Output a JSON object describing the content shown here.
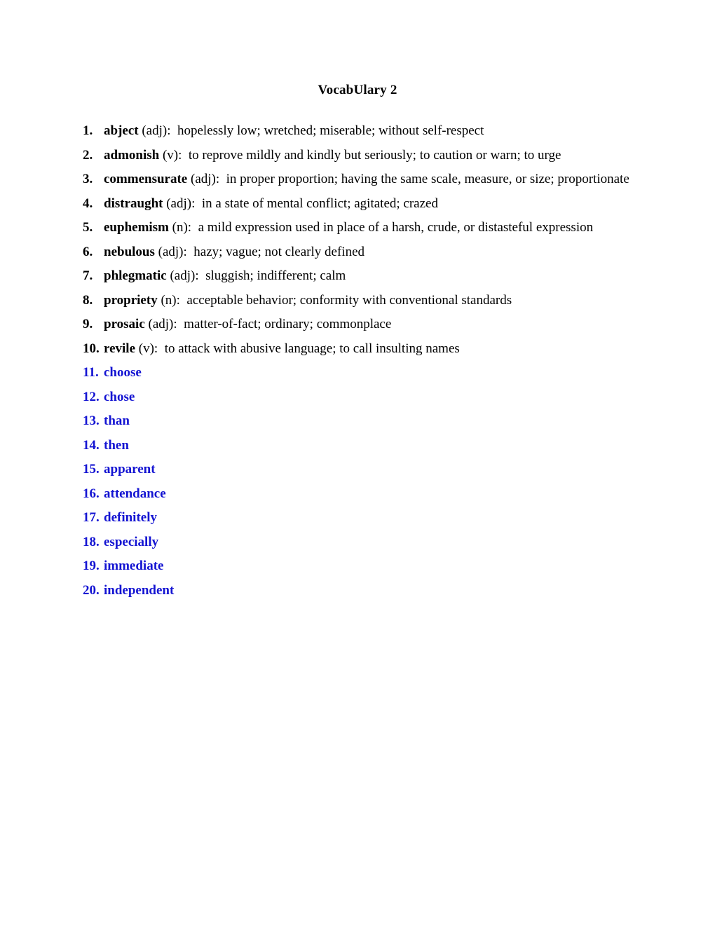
{
  "document": {
    "title": "VocabUlary 2",
    "accent_blue": "#1414d2",
    "text_color": "#000000",
    "background": "#ffffff"
  },
  "items": [
    {
      "number": "1.",
      "term": "abject",
      "pos": "(adj):",
      "definition": "hopelessly low; wretched; miserable; without self-respect",
      "style": "defined"
    },
    {
      "number": "2.",
      "term": "admonish",
      "pos": "(v):",
      "definition": "to reprove mildly and kindly but seriously; to caution or warn; to urge",
      "style": "defined"
    },
    {
      "number": "3.",
      "term": "commensurate",
      "pos": "(adj):",
      "definition": "in proper proportion; having the same scale, measure, or size; proportionate",
      "style": "defined"
    },
    {
      "number": "4.",
      "term": "distraught",
      "pos": "(adj):",
      "definition": "in a state of mental conflict; agitated; crazed",
      "style": "defined"
    },
    {
      "number": "5.",
      "term": "euphemism",
      "pos": "(n):",
      "definition": "a mild expression used in place of a harsh, crude, or distasteful expression",
      "style": "defined"
    },
    {
      "number": "6.",
      "term": "nebulous",
      "pos": "(adj):",
      "definition": "hazy; vague; not clearly defined",
      "style": "defined"
    },
    {
      "number": "7.",
      "term": "phlegmatic",
      "pos": "(adj):",
      "definition": "sluggish; indifferent; calm",
      "style": "defined"
    },
    {
      "number": "8.",
      "term": "propriety",
      "pos": "(n):",
      "definition": "acceptable behavior; conformity with conventional standards",
      "style": "defined"
    },
    {
      "number": "9.",
      "term": "prosaic",
      "pos": "(adj):",
      "definition": "matter-of-fact; ordinary; commonplace",
      "style": "defined"
    },
    {
      "number": "10.",
      "term": "revile",
      "pos": "(v):",
      "definition": "to attack with abusive language; to call insulting names",
      "style": "defined"
    },
    {
      "number": "11.",
      "term": "choose",
      "pos": "",
      "definition": "",
      "style": "plain"
    },
    {
      "number": "12.",
      "term": "chose",
      "pos": "",
      "definition": "",
      "style": "plain"
    },
    {
      "number": "13.",
      "term": "than",
      "pos": "",
      "definition": "",
      "style": "plain"
    },
    {
      "number": "14.",
      "term": "then",
      "pos": "",
      "definition": "",
      "style": "plain"
    },
    {
      "number": "15.",
      "term": "apparent",
      "pos": "",
      "definition": "",
      "style": "plain"
    },
    {
      "number": "16.",
      "term": "attendance",
      "pos": "",
      "definition": "",
      "style": "plain"
    },
    {
      "number": "17.",
      "term": "definitely",
      "pos": "",
      "definition": "",
      "style": "plain"
    },
    {
      "number": "18.",
      "term": "especially",
      "pos": "",
      "definition": "",
      "style": "plain"
    },
    {
      "number": "19.",
      "term": "immediate",
      "pos": "",
      "definition": "",
      "style": "plain"
    },
    {
      "number": "20.",
      "term": "independent",
      "pos": "",
      "definition": "",
      "style": "plain"
    }
  ]
}
